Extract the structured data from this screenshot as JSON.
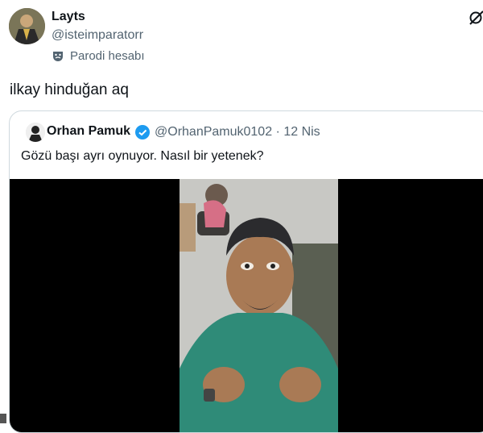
{
  "tweet": {
    "display_name": "Layts",
    "handle": "@isteimparatorr",
    "parody_label": "Parodi hesabı",
    "text": "ilkay hinduğan aq"
  },
  "quote": {
    "display_name": "Orhan Pamuk",
    "handle_date": "@OrhanPamuk0102 · 12 Nis",
    "text": "Gözü başı ayrı oynuyor. Nasıl bir yetenek?"
  },
  "icons": {
    "parody": "theater-mask-icon",
    "grok": "grok-icon",
    "verified": "verified-badge-icon"
  },
  "colors": {
    "verified": "#1d9bf0",
    "secondary_text": "#536471",
    "border": "#cfd9de"
  }
}
